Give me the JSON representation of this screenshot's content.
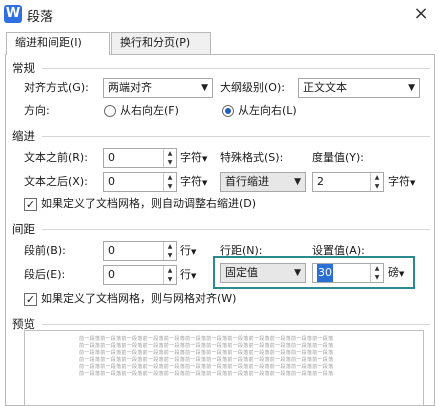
{
  "window": {
    "title": "段落",
    "close_glyph": "×"
  },
  "tabs": [
    {
      "label": "缩进和间距(I)"
    },
    {
      "label": "换行和分页(P)"
    }
  ],
  "general": {
    "header": "常规",
    "align_label": "对齐方式(G):",
    "align_value": "两端对齐",
    "outline_label": "大纲级别(O):",
    "outline_value": "正文文本",
    "direction_label": "方向:",
    "rtl_label": "从右向左(F)",
    "ltr_label": "从左向右(L)"
  },
  "indent": {
    "header": "缩进",
    "before_label": "文本之前(R):",
    "before_value": "0",
    "before_unit": "字符",
    "after_label": "文本之后(X):",
    "after_value": "0",
    "after_unit": "字符",
    "special_label": "特殊格式(S):",
    "special_value": "首行缩进",
    "measure_label": "度量值(Y):",
    "measure_value": "2",
    "measure_unit": "字符",
    "grid_check_label": "如果定义了文档网格，则自动调整右缩进(D)"
  },
  "spacing": {
    "header": "间距",
    "before_label": "段前(B):",
    "before_value": "0",
    "before_unit": "行",
    "after_label": "段后(E):",
    "after_value": "0",
    "after_unit": "行",
    "line_label": "行距(N):",
    "line_value": "固定值",
    "setting_label": "设置值(A):",
    "setting_value": "30",
    "setting_unit": "磅",
    "grid_check_label": "如果定义了文档网格，则与网格对齐(W)"
  },
  "preview": {
    "header": "预览",
    "lines": [
      "前一段落前一段落前一段落前一段落前一段落前一段落前一段落前一段落前一段落前一段落前一段落前一段落",
      "前一段落前一段落前一段落前一段落前一段落前一段落前一段落前一段落前一段落前一段落前一段落前一段落",
      "前一段落前一段落前一段落前一段落前一段落前一段落前一段落前一段落前一段落前一段落前一段落前一段落",
      "前一段落前一段落前一段落前一段落前一段落前一段落前一段落前一段落前一段落前一段落前一段落前一段落",
      "前一段落前一段落前一段落前一段落前一段落前一段落前一段落前一段落前一段落前一段落前一段落前一段落",
      "前一段落前一段落前一段落前一段落前一段落前一段落前一段落前一段落前一段落前一段落前一段落前一段落"
    ]
  },
  "colors": {
    "highlight": "#2a8a8e",
    "selection": "#2b6fd6",
    "app_icon": "#2f6fe0"
  },
  "icons": {
    "app": "wps-writer-icon",
    "close": "close-icon",
    "dropdown": "chevron-down-icon",
    "spin": "spin-arrows-icon"
  }
}
